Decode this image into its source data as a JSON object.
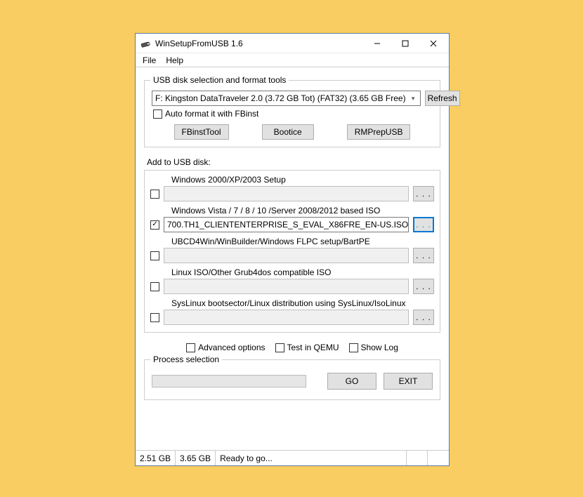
{
  "window": {
    "title": "WinSetupFromUSB 1.6"
  },
  "menu": {
    "file": "File",
    "help": "Help"
  },
  "disk_group": {
    "legend": "USB disk selection and format tools",
    "selected_disk": "F: Kingston DataTraveler 2.0 (3.72 GB Tot) (FAT32) (3.65 GB Free)",
    "refresh": "Refresh",
    "auto_format_label": "Auto format it with FBinst",
    "fbinst": "FBinstTool",
    "bootice": "Bootice",
    "rmprep": "RMPrepUSB"
  },
  "add_section": {
    "label": "Add to USB disk:",
    "items": [
      {
        "label": "Windows 2000/XP/2003 Setup",
        "checked": false,
        "value": "",
        "active": false
      },
      {
        "label": "Windows Vista / 7 / 8 / 10 /Server 2008/2012 based ISO",
        "checked": true,
        "value": "700.TH1_CLIENTENTERPRISE_S_EVAL_X86FRE_EN-US.ISO",
        "active": true
      },
      {
        "label": "UBCD4Win/WinBuilder/Windows FLPC setup/BartPE",
        "checked": false,
        "value": "",
        "active": false
      },
      {
        "label": "Linux ISO/Other Grub4dos compatible ISO",
        "checked": false,
        "value": "",
        "active": false
      },
      {
        "label": "SysLinux bootsector/Linux distribution using SysLinux/IsoLinux",
        "checked": false,
        "value": "",
        "active": false
      }
    ]
  },
  "options": {
    "advanced": "Advanced options",
    "qemu": "Test in QEMU",
    "showlog": "Show Log"
  },
  "process": {
    "legend": "Process selection",
    "go": "GO",
    "exit": "EXIT"
  },
  "status": {
    "size1": "2.51 GB",
    "size2": "3.65 GB",
    "msg": "Ready to go..."
  },
  "ellipsis": ". . ."
}
